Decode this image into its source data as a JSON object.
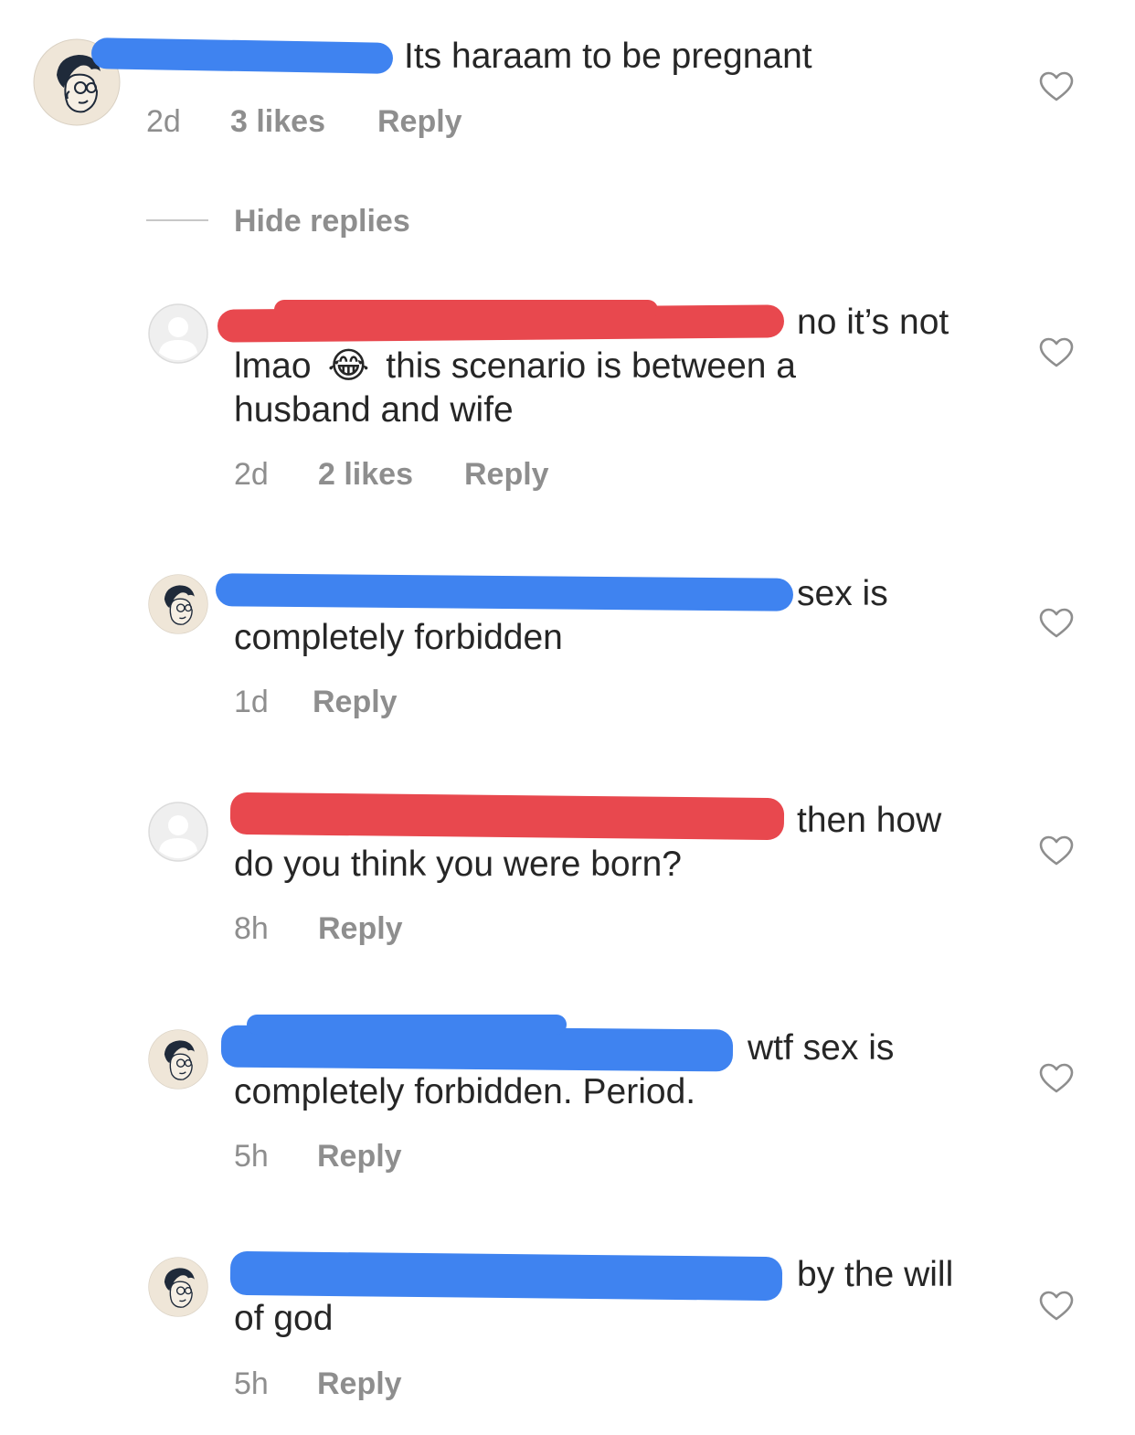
{
  "comments": [
    {
      "text": "Its haraam to be pregnant",
      "time": "2d",
      "likes": "3 likes",
      "reply": "Reply",
      "avatar": "cartoon-avatar-icon",
      "redaction_color": "#3f83f0"
    }
  ],
  "hide_replies": "Hide replies",
  "replies": [
    {
      "line1": "no it’s not",
      "line2_a": "lmao",
      "emoji": "😂",
      "line2_b": "this scenario is between a",
      "line3": "husband and wife",
      "time": "2d",
      "likes": "2 likes",
      "reply": "Reply",
      "avatar": "default-avatar-icon",
      "redaction_color": "#e8484e"
    },
    {
      "line1": "sex is",
      "line2": "completely forbidden",
      "time": "1d",
      "reply": "Reply",
      "avatar": "cartoon-avatar-icon",
      "redaction_color": "#3f83f0"
    },
    {
      "line1": "then how",
      "line2": "do you think you were born?",
      "time": "8h",
      "reply": "Reply",
      "avatar": "default-avatar-icon",
      "redaction_color": "#e8484e"
    },
    {
      "line1": "wtf sex is",
      "line2": "completely forbidden. Period.",
      "time": "5h",
      "reply": "Reply",
      "avatar": "cartoon-avatar-icon",
      "redaction_color": "#3f83f0"
    },
    {
      "line1": "by the will",
      "line2": "of god",
      "time": "5h",
      "reply": "Reply",
      "avatar": "cartoon-avatar-icon",
      "redaction_color": "#3f83f0"
    }
  ],
  "icons": {
    "like": "heart-outline-icon"
  },
  "colors": {
    "text": "#262626",
    "secondary": "#8e8e8e",
    "blue_redaction": "#3f83f0",
    "red_redaction": "#e8484e"
  }
}
